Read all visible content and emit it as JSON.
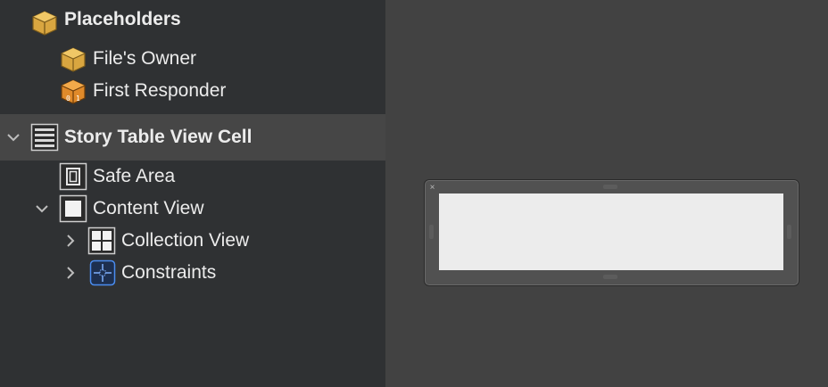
{
  "outline": {
    "items": [
      {
        "label": "Placeholders",
        "icon": "placeholder-cube-icon",
        "bold": true
      },
      {
        "label": "File's Owner",
        "icon": "placeholder-cube-icon"
      },
      {
        "label": "First Responder",
        "icon": "first-responder-icon"
      },
      {
        "label": "Story Table View Cell",
        "icon": "table-view-cell-icon",
        "bold": true,
        "expanded": true,
        "selected": true
      },
      {
        "label": "Safe Area",
        "icon": "safe-area-icon"
      },
      {
        "label": "Content View",
        "icon": "view-icon",
        "expanded": true
      },
      {
        "label": "Collection View",
        "icon": "collection-view-icon",
        "expanded": false
      },
      {
        "label": "Constraints",
        "icon": "constraints-icon",
        "expanded": false
      }
    ]
  },
  "canvas": {
    "cell_close_glyph": "×"
  },
  "colors": {
    "outline_bg": "#2f3133",
    "canvas_bg": "#424242",
    "selection": "#464646",
    "placeholder_icon": "#e2b44a",
    "constraints_icon": "#2f6fd6"
  }
}
